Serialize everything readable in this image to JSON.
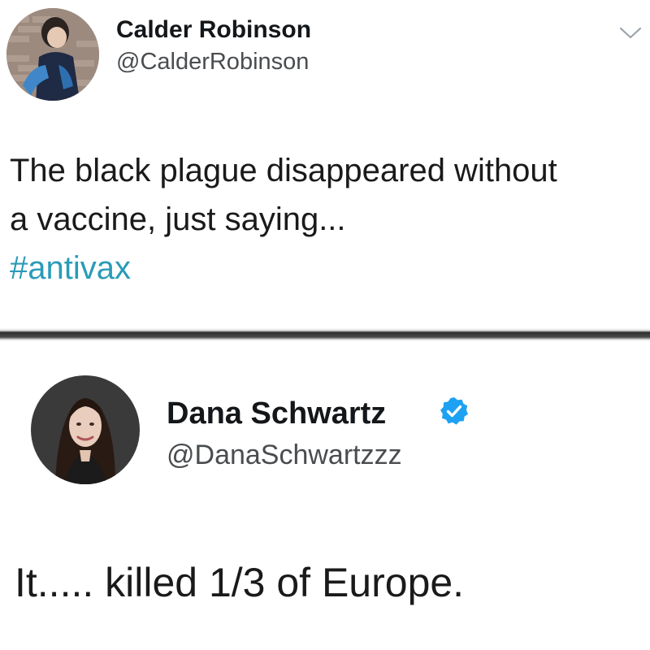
{
  "tweet1": {
    "display_name": "Calder Robinson",
    "handle": "@CalderRobinson",
    "text_line1": "The black plague disappeared without",
    "text_line2": "a vaccine, just saying...",
    "hashtag": "#antivax",
    "avatar_icon": "user-photo-avatar",
    "menu_icon": "chevron-down-icon"
  },
  "tweet2": {
    "display_name": "Dana Schwartz",
    "handle": "@DanaSchwartzzz",
    "text": "It..... killed 1/3 of Europe.",
    "avatar_icon": "user-photo-avatar",
    "verified_icon": "verified-badge-icon"
  },
  "colors": {
    "hashtag": "#2a9bb8",
    "verified": "#1da1f2",
    "text": "#1a1a1a",
    "handle": "#4a4d50"
  }
}
